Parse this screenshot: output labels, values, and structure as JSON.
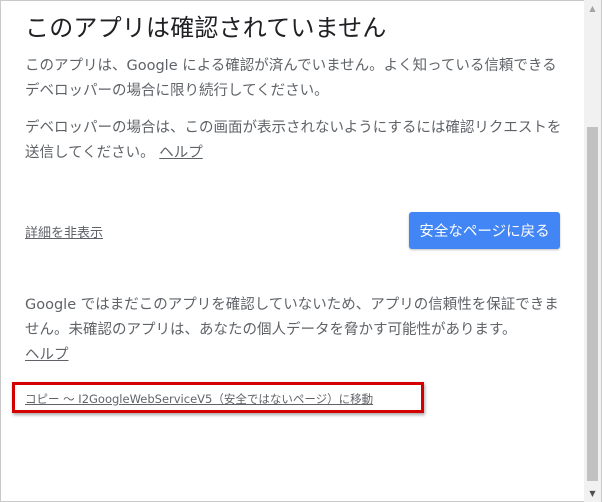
{
  "page": {
    "title": "このアプリは確認されていません",
    "paragraph1": "このアプリは、Google による確認が済んでいません。よく知っている信頼できるデベロッパーの場合に限り続行してください。",
    "paragraph2_text": "デベロッパーの場合は、この画面が表示されないようにするには確認リクエストを送信してください。",
    "paragraph2_help": "ヘルプ",
    "hide_details_label": "詳細を非表示",
    "back_to_safety_label": "安全なページに戻る",
    "paragraph3_text": "Google ではまだこのアプリを確認していないため、アプリの信頼性を保証できません。未確認のアプリは、あなたの個人データを脅かす可能性があります。",
    "paragraph3_help": "ヘルプ",
    "proceed_link_label": "コピー ～ I2GoogleWebServiceV5（安全ではないページ）に移動"
  },
  "colors": {
    "button_bg": "#4285f4",
    "highlight_border": "#d40000",
    "text": "#5f6368",
    "title": "#202124"
  },
  "icons": {
    "scroll_up": "triangle-up",
    "scroll_down": "triangle-down"
  }
}
